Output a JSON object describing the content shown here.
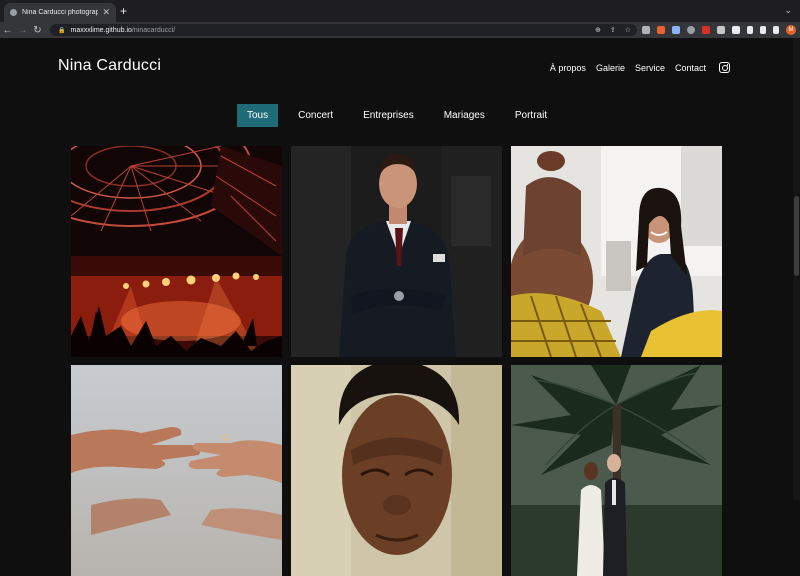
{
  "browser": {
    "tab_title": "Nina Carducci photographe b",
    "url_host": "maxxxlime.github.io",
    "url_path": "/ninacarducci/",
    "avatar_letter": "M"
  },
  "site": {
    "brand": "Nina Carducci",
    "nav": [
      "À propos",
      "Galerie",
      "Service",
      "Contact"
    ]
  },
  "gallery": {
    "filters": [
      "Tous",
      "Concert",
      "Entreprises",
      "Mariages",
      "Portrait"
    ],
    "active_filter": "Tous"
  },
  "colors": {
    "accent": "#1f6b78",
    "background": "#0f0f0f"
  }
}
